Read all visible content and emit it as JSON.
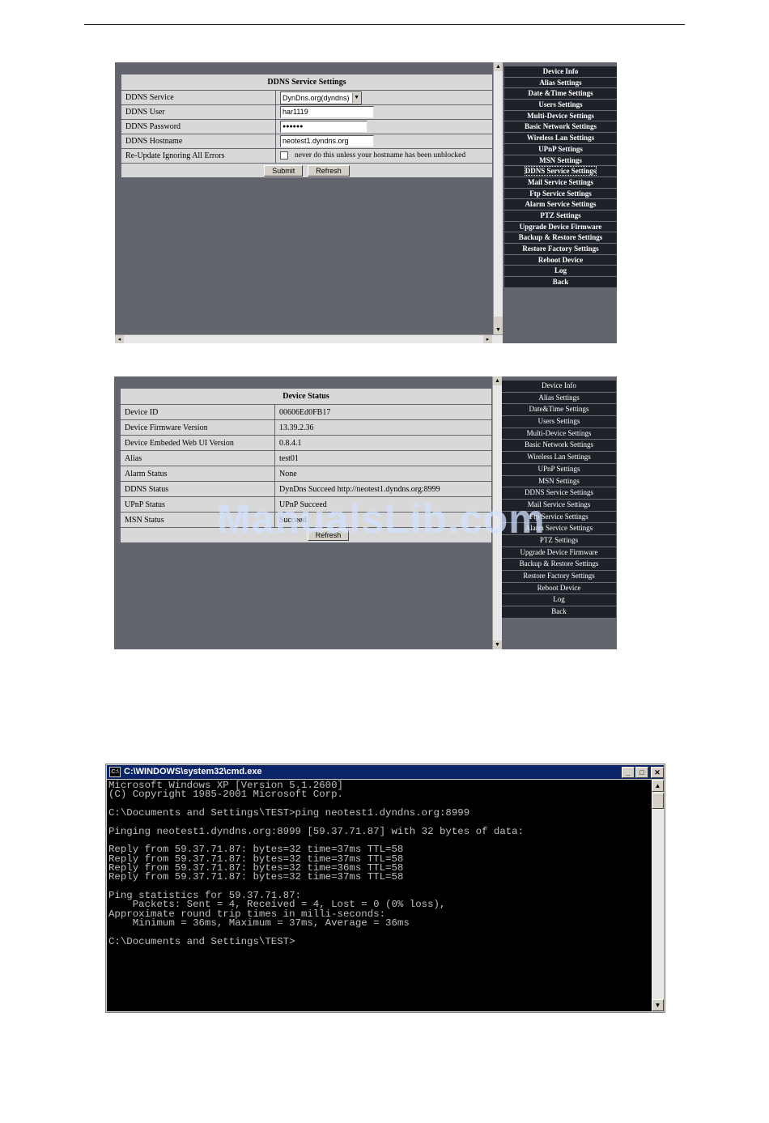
{
  "panel1": {
    "heading": "DDNS Service Settings",
    "fields": {
      "service_label": "DDNS Service",
      "service_value": "DynDns.org(dyndns)",
      "user_label": "DDNS User",
      "user_value": "har1119",
      "password_label": "DDNS Password",
      "password_value": "●●●●●●",
      "hostname_label": "DDNS Hostname",
      "hostname_value": "neotest1.dyndns.org",
      "reupdate_label": "Re-Update Ignoring All Errors",
      "reupdate_note": "never do this unless your hostname has been unblocked"
    },
    "submit_label": "Submit",
    "refresh_label": "Refresh",
    "menu": [
      "Device Info",
      "Alias Settings",
      "Date &Time Settings",
      "Users Settings",
      "Multi-Device Settings",
      "Basic Network Settings",
      "Wireless Lan Settings",
      "UPnP Settings",
      "MSN Settings",
      "DDNS Service Settings",
      "Mail Service Settings",
      "Ftp Service Settings",
      "Alarm Service Settings",
      "PTZ Settings",
      "Upgrade Device Firmware",
      "Backup & Restore Settings",
      "Restore Factory Settings",
      "Reboot Device",
      "Log",
      "Back"
    ],
    "active_menu": "DDNS Service Settings"
  },
  "panel2": {
    "heading": "Device Status",
    "rows": [
      {
        "label": "Device ID",
        "value": "00606Ed0FB17"
      },
      {
        "label": "Device Firmware Version",
        "value": "13.39.2.36"
      },
      {
        "label": "Device Embeded Web UI Version",
        "value": "0.8.4.1"
      },
      {
        "label": "Alias",
        "value": "test01"
      },
      {
        "label": "Alarm Status",
        "value": "None"
      },
      {
        "label": "DDNS Status",
        "value": "DynDns Succeed  http://neotest1.dyndns.org:8999"
      },
      {
        "label": "UPnP Status",
        "value": "UPnP Succeed"
      },
      {
        "label": "MSN Status",
        "value": "Succeed"
      }
    ],
    "refresh_label": "Refresh",
    "menu": [
      "Device Info",
      "Alias Settings",
      "Date&Time Settings",
      "Users Settings",
      "Multi-Device Settings",
      "Basic Network Settings",
      "Wireless Lan Settings",
      "UPnP Settings",
      "MSN Settings",
      "DDNS Service Settings",
      "Mail Service Settings",
      "Ftp Service Settings",
      "Alarm Service Settings",
      "PTZ Settings",
      "Upgrade Device Firmware",
      "Backup & Restore Settings",
      "Restore Factory Settings",
      "Reboot Device",
      "Log",
      "Back"
    ]
  },
  "watermark": "ManualsLib.com",
  "cmd": {
    "title": "C:\\WINDOWS\\system32\\cmd.exe",
    "lines": [
      "Microsoft Windows XP [Version 5.1.2600]",
      "(C) Copyright 1985-2001 Microsoft Corp.",
      "",
      "C:\\Documents and Settings\\TEST>ping neotest1.dyndns.org:8999",
      "",
      "Pinging neotest1.dyndns.org:8999 [59.37.71.87] with 32 bytes of data:",
      "",
      "Reply from 59.37.71.87: bytes=32 time=37ms TTL=58",
      "Reply from 59.37.71.87: bytes=32 time=37ms TTL=58",
      "Reply from 59.37.71.87: bytes=32 time=36ms TTL=58",
      "Reply from 59.37.71.87: bytes=32 time=37ms TTL=58",
      "",
      "Ping statistics for 59.37.71.87:",
      "    Packets: Sent = 4, Received = 4, Lost = 0 (0% loss),",
      "Approximate round trip times in milli-seconds:",
      "    Minimum = 36ms, Maximum = 37ms, Average = 36ms",
      "",
      "C:\\Documents and Settings\\TEST>"
    ]
  }
}
